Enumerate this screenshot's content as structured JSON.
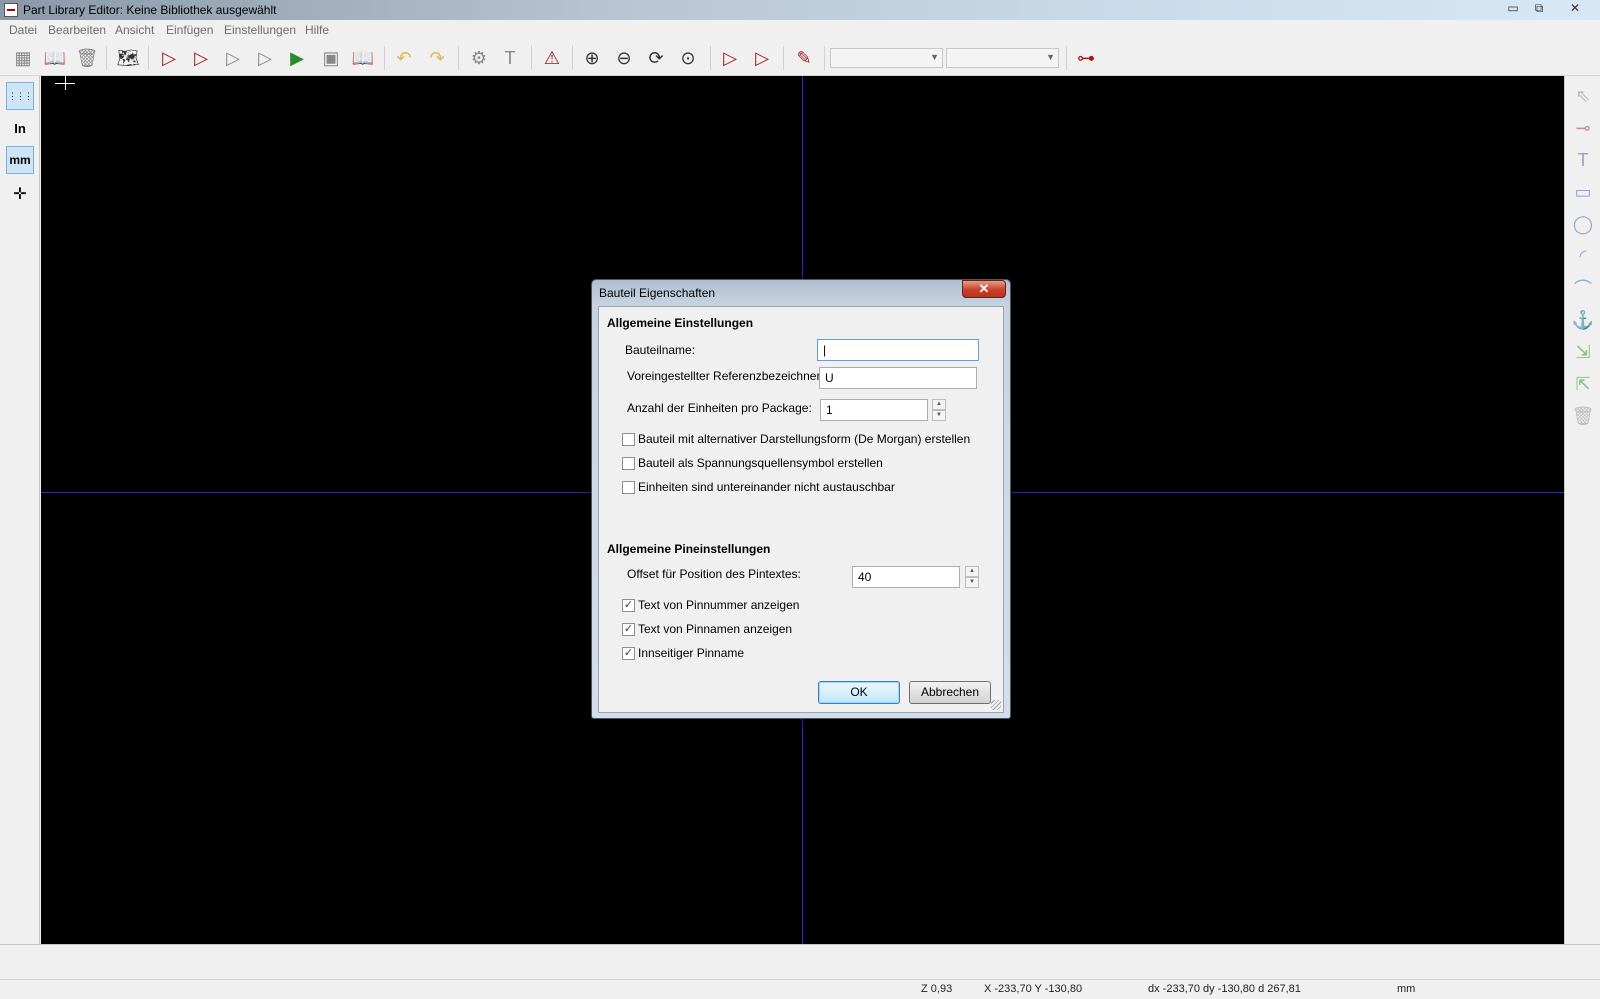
{
  "window": {
    "title": "Part Library Editor: Keine Bibliothek ausgewählt",
    "controls": {
      "minimize": "▭",
      "restore": "⧉",
      "close": "✕"
    }
  },
  "menu": [
    "Datei",
    "Bearbeiten",
    "Ansicht",
    "Einfügen",
    "Einstellungen",
    "Hilfe"
  ],
  "toolbar": {
    "icons": {
      "save_library": "▦",
      "select_library": "📖",
      "delete_part": "🗑",
      "browse_libraries": "🗺",
      "new_part": "▷",
      "load_part": "▷",
      "save_part": "▷",
      "new_part_disabled": "▷",
      "import_part": "▶",
      "export_part": "▣",
      "create_library": "📖",
      "undo": "↶",
      "redo": "↷",
      "part_properties": "⚙",
      "field_properties": "T",
      "check_pins": "⚠",
      "zoom_in": "⊕",
      "zoom_out": "⊖",
      "redraw": "⟳",
      "zoom_fit": "⊙",
      "normal_body": "▷",
      "de_morgan": "▷",
      "datasheet": "✎",
      "pin_table": "⊶"
    },
    "unit_select_value": "",
    "alias_select_value": ""
  },
  "left_toolbar": {
    "grid_icon": "⋮⋮⋮",
    "inch_label": "In",
    "mm_label": "mm",
    "cursor_icon": "✛"
  },
  "right_toolbar": {
    "icons": [
      "⇖",
      "⊸",
      "T",
      "▭",
      "◯",
      "◜",
      "⌒",
      "⚓",
      "⇲",
      "⇱",
      "🗑"
    ]
  },
  "dialog": {
    "title": "Bauteil Eigenschaften",
    "close_icon": "✕",
    "general_section": "Allgemeine Einstellungen",
    "part_name_label": "Bauteilname:",
    "part_name_value": "|",
    "reference_label": "Voreingestellter Referenzbezeichner:",
    "reference_value": "U",
    "units_label": "Anzahl der Einheiten pro Package:",
    "units_value": "1",
    "spin_up": "▲",
    "spin_down": "▼",
    "checkbox_demorgan": "Bauteil mit alternativer Darstellungsform (De Morgan) erstellen",
    "checkbox_power": "Bauteil als Spannungsquellensymbol erstellen",
    "checkbox_locked": "Einheiten sind untereinander nicht austauschbar",
    "pin_section": "Allgemeine Pineinstellungen",
    "pin_offset_label": "Offset für Position des Pintextes:",
    "pin_offset_value": "40",
    "show_pin_number": "Text von Pinnummer anzeigen",
    "show_pin_name": "Text von Pinnamen anzeigen",
    "pin_name_inside": "Innseitiger Pinname",
    "check_mark": "✓",
    "ok_label": "OK",
    "cancel_label": "Abbrechen"
  },
  "status": {
    "zoom": "Z 0,93",
    "xy": "X -233,70  Y -130,80",
    "dxy": "dx -233,70  dy -130,80  d 267,81",
    "units": "mm"
  }
}
